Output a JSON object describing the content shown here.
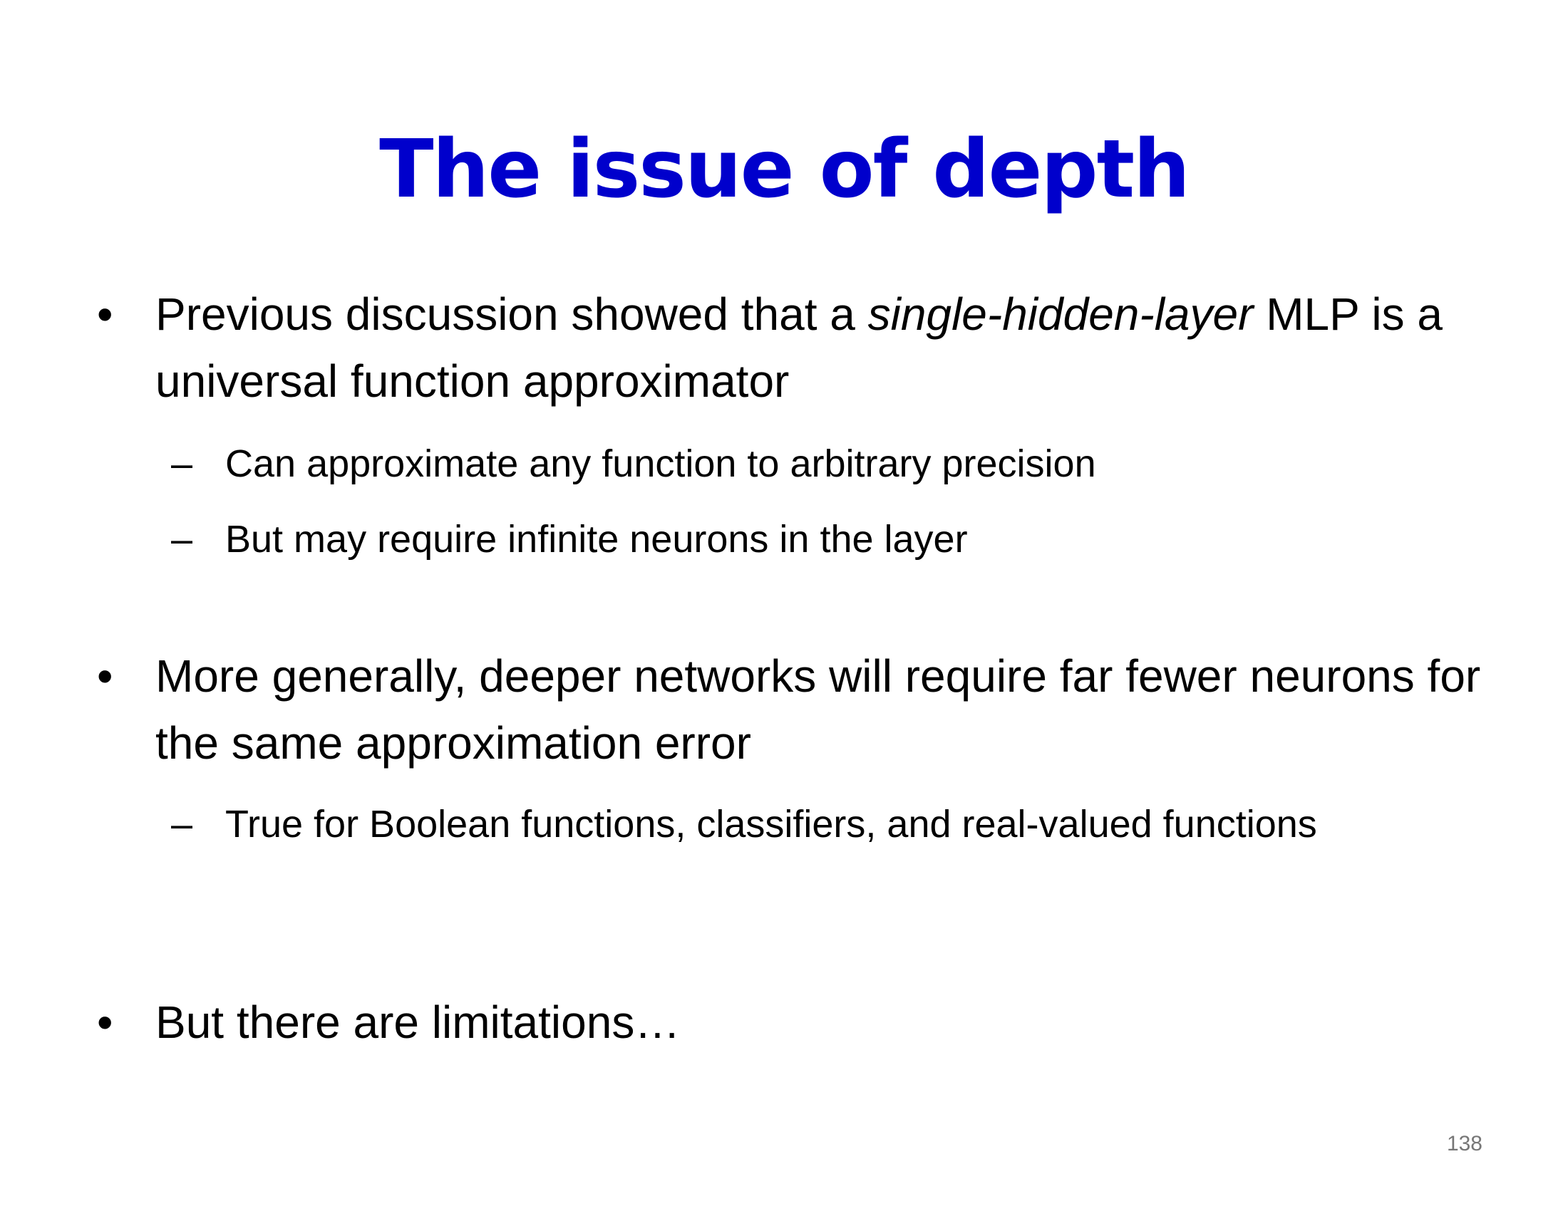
{
  "slide": {
    "title": "The issue of depth",
    "bullet_mark": "•",
    "dash_mark": "–",
    "bullets": [
      {
        "text_before": "Previous discussion showed that a ",
        "emphasis": "single-hidden-layer",
        "text_after": " MLP is a universal function approximator",
        "sub": [
          "Can approximate any function to arbitrary precision",
          "But may require infinite neurons in the layer"
        ]
      },
      {
        "text": "More generally, deeper networks will require far fewer neurons for the same approximation error",
        "sub": [
          "True for Boolean functions, classifiers, and real-valued functions"
        ]
      },
      {
        "text": "But there are limitations…"
      }
    ],
    "page_number": "138"
  }
}
